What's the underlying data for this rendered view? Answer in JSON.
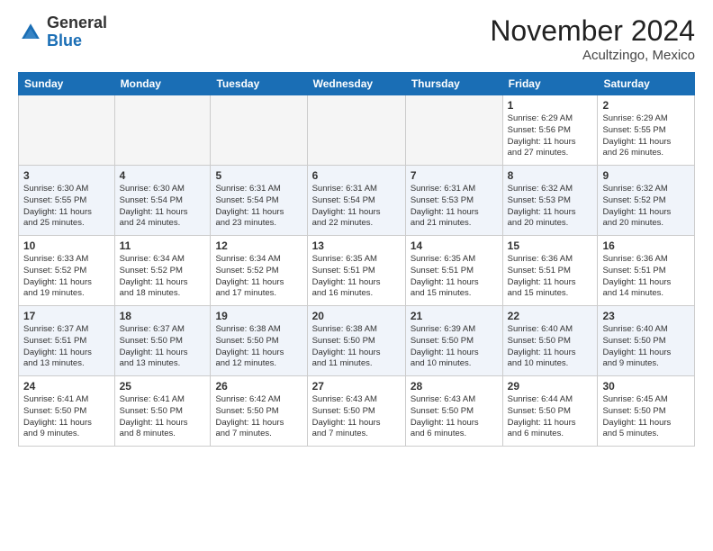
{
  "header": {
    "logo_line1": "General",
    "logo_line2": "Blue",
    "month": "November 2024",
    "location": "Acultzingo, Mexico"
  },
  "weekdays": [
    "Sunday",
    "Monday",
    "Tuesday",
    "Wednesday",
    "Thursday",
    "Friday",
    "Saturday"
  ],
  "weeks": [
    [
      {
        "day": "",
        "info": ""
      },
      {
        "day": "",
        "info": ""
      },
      {
        "day": "",
        "info": ""
      },
      {
        "day": "",
        "info": ""
      },
      {
        "day": "",
        "info": ""
      },
      {
        "day": "1",
        "info": "Sunrise: 6:29 AM\nSunset: 5:56 PM\nDaylight: 11 hours\nand 27 minutes."
      },
      {
        "day": "2",
        "info": "Sunrise: 6:29 AM\nSunset: 5:55 PM\nDaylight: 11 hours\nand 26 minutes."
      }
    ],
    [
      {
        "day": "3",
        "info": "Sunrise: 6:30 AM\nSunset: 5:55 PM\nDaylight: 11 hours\nand 25 minutes."
      },
      {
        "day": "4",
        "info": "Sunrise: 6:30 AM\nSunset: 5:54 PM\nDaylight: 11 hours\nand 24 minutes."
      },
      {
        "day": "5",
        "info": "Sunrise: 6:31 AM\nSunset: 5:54 PM\nDaylight: 11 hours\nand 23 minutes."
      },
      {
        "day": "6",
        "info": "Sunrise: 6:31 AM\nSunset: 5:54 PM\nDaylight: 11 hours\nand 22 minutes."
      },
      {
        "day": "7",
        "info": "Sunrise: 6:31 AM\nSunset: 5:53 PM\nDaylight: 11 hours\nand 21 minutes."
      },
      {
        "day": "8",
        "info": "Sunrise: 6:32 AM\nSunset: 5:53 PM\nDaylight: 11 hours\nand 20 minutes."
      },
      {
        "day": "9",
        "info": "Sunrise: 6:32 AM\nSunset: 5:52 PM\nDaylight: 11 hours\nand 20 minutes."
      }
    ],
    [
      {
        "day": "10",
        "info": "Sunrise: 6:33 AM\nSunset: 5:52 PM\nDaylight: 11 hours\nand 19 minutes."
      },
      {
        "day": "11",
        "info": "Sunrise: 6:34 AM\nSunset: 5:52 PM\nDaylight: 11 hours\nand 18 minutes."
      },
      {
        "day": "12",
        "info": "Sunrise: 6:34 AM\nSunset: 5:52 PM\nDaylight: 11 hours\nand 17 minutes."
      },
      {
        "day": "13",
        "info": "Sunrise: 6:35 AM\nSunset: 5:51 PM\nDaylight: 11 hours\nand 16 minutes."
      },
      {
        "day": "14",
        "info": "Sunrise: 6:35 AM\nSunset: 5:51 PM\nDaylight: 11 hours\nand 15 minutes."
      },
      {
        "day": "15",
        "info": "Sunrise: 6:36 AM\nSunset: 5:51 PM\nDaylight: 11 hours\nand 15 minutes."
      },
      {
        "day": "16",
        "info": "Sunrise: 6:36 AM\nSunset: 5:51 PM\nDaylight: 11 hours\nand 14 minutes."
      }
    ],
    [
      {
        "day": "17",
        "info": "Sunrise: 6:37 AM\nSunset: 5:51 PM\nDaylight: 11 hours\nand 13 minutes."
      },
      {
        "day": "18",
        "info": "Sunrise: 6:37 AM\nSunset: 5:50 PM\nDaylight: 11 hours\nand 13 minutes."
      },
      {
        "day": "19",
        "info": "Sunrise: 6:38 AM\nSunset: 5:50 PM\nDaylight: 11 hours\nand 12 minutes."
      },
      {
        "day": "20",
        "info": "Sunrise: 6:38 AM\nSunset: 5:50 PM\nDaylight: 11 hours\nand 11 minutes."
      },
      {
        "day": "21",
        "info": "Sunrise: 6:39 AM\nSunset: 5:50 PM\nDaylight: 11 hours\nand 10 minutes."
      },
      {
        "day": "22",
        "info": "Sunrise: 6:40 AM\nSunset: 5:50 PM\nDaylight: 11 hours\nand 10 minutes."
      },
      {
        "day": "23",
        "info": "Sunrise: 6:40 AM\nSunset: 5:50 PM\nDaylight: 11 hours\nand 9 minutes."
      }
    ],
    [
      {
        "day": "24",
        "info": "Sunrise: 6:41 AM\nSunset: 5:50 PM\nDaylight: 11 hours\nand 9 minutes."
      },
      {
        "day": "25",
        "info": "Sunrise: 6:41 AM\nSunset: 5:50 PM\nDaylight: 11 hours\nand 8 minutes."
      },
      {
        "day": "26",
        "info": "Sunrise: 6:42 AM\nSunset: 5:50 PM\nDaylight: 11 hours\nand 7 minutes."
      },
      {
        "day": "27",
        "info": "Sunrise: 6:43 AM\nSunset: 5:50 PM\nDaylight: 11 hours\nand 7 minutes."
      },
      {
        "day": "28",
        "info": "Sunrise: 6:43 AM\nSunset: 5:50 PM\nDaylight: 11 hours\nand 6 minutes."
      },
      {
        "day": "29",
        "info": "Sunrise: 6:44 AM\nSunset: 5:50 PM\nDaylight: 11 hours\nand 6 minutes."
      },
      {
        "day": "30",
        "info": "Sunrise: 6:45 AM\nSunset: 5:50 PM\nDaylight: 11 hours\nand 5 minutes."
      }
    ]
  ],
  "colors": {
    "header_bg": "#1a6eb5",
    "header_text": "#ffffff",
    "alt_row_bg": "#eef2f8"
  }
}
